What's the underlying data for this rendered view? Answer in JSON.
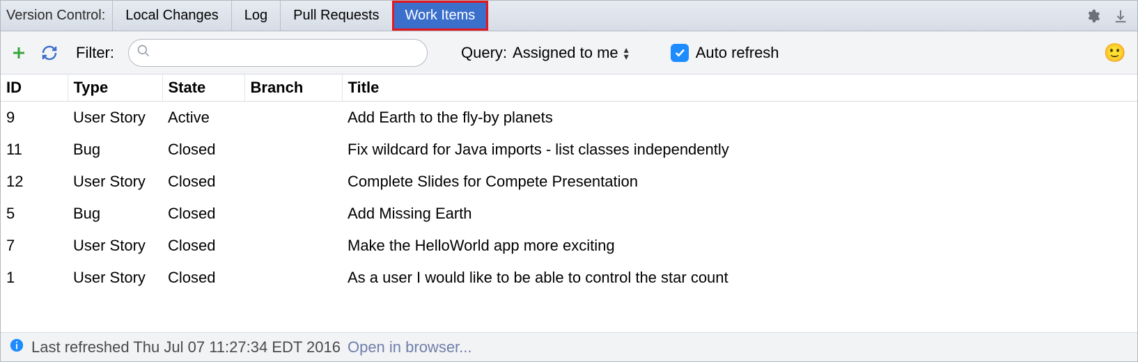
{
  "header": {
    "label": "Version Control:",
    "tabs": [
      {
        "label": "Local Changes"
      },
      {
        "label": "Log"
      },
      {
        "label": "Pull Requests"
      },
      {
        "label": "Work Items",
        "active": true
      }
    ]
  },
  "toolbar": {
    "filter_label": "Filter:",
    "search_value": "",
    "query_label": "Query:",
    "query_value": "Assigned to me",
    "auto_refresh_label": "Auto refresh",
    "auto_refresh_checked": true
  },
  "columns": {
    "id": "ID",
    "type": "Type",
    "state": "State",
    "branch": "Branch",
    "title": "Title"
  },
  "rows": [
    {
      "id": "9",
      "type": "User Story",
      "state": "Active",
      "branch": "",
      "title": "Add Earth to the fly-by planets"
    },
    {
      "id": "11",
      "type": "Bug",
      "state": "Closed",
      "branch": "",
      "title": "Fix wildcard for Java imports - list classes independently"
    },
    {
      "id": "12",
      "type": "User Story",
      "state": "Closed",
      "branch": "",
      "title": "Complete Slides for Compete Presentation"
    },
    {
      "id": "5",
      "type": "Bug",
      "state": "Closed",
      "branch": "",
      "title": "Add Missing Earth"
    },
    {
      "id": "7",
      "type": "User Story",
      "state": "Closed",
      "branch": "",
      "title": "Make the HelloWorld app more exciting"
    },
    {
      "id": "1",
      "type": "User Story",
      "state": "Closed",
      "branch": "",
      "title": "As a user I would like to be able to control the star count"
    }
  ],
  "footer": {
    "text": "Last refreshed Thu Jul 07 11:27:34 EDT 2016",
    "link": "Open in browser..."
  }
}
